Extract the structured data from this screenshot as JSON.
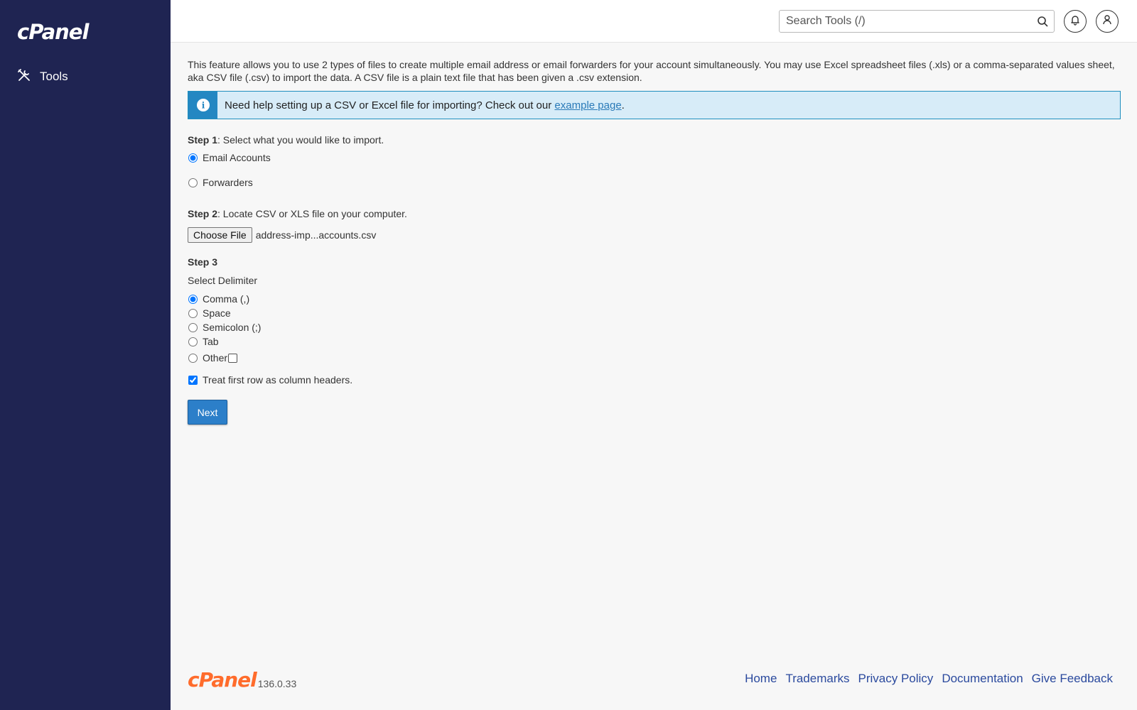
{
  "brand": {
    "logo_text": "cPanel",
    "version": "136.0.33"
  },
  "sidebar": {
    "items": [
      {
        "label": "Tools",
        "icon": "tools-icon"
      }
    ]
  },
  "header": {
    "search_placeholder": "Search Tools (/)"
  },
  "intro_text": "This feature allows you to use 2 types of files to create multiple email address or email forwarders for your account simultaneously. You may use Excel spreadsheet files (.xls) or a comma-separated values sheet, aka CSV file (.csv) to import the data. A CSV file is a plain text file that has been given a .csv extension.",
  "alert": {
    "text": "Need help setting up a CSV or Excel file for importing? Check out our",
    "link": "example page",
    "suffix": "."
  },
  "step1": {
    "label": "Step 1",
    "text": ": Select what you would like to import.",
    "options": [
      {
        "label": "Email Accounts",
        "checked": true
      },
      {
        "label": "Forwarders",
        "checked": false
      }
    ]
  },
  "step2": {
    "label": "Step 2",
    "text": ": Locate CSV or XLS file on your computer.",
    "button": "Choose File",
    "file_name": "address-imp...accounts.csv"
  },
  "step3": {
    "label": "Step 3",
    "delimiter_label": "Select Delimiter",
    "options": [
      {
        "label": "Comma (,)",
        "checked": true
      },
      {
        "label": "Space",
        "checked": false
      },
      {
        "label": "Semicolon (;)",
        "checked": false
      },
      {
        "label": "Tab",
        "checked": false
      },
      {
        "label": "Other",
        "checked": false
      }
    ],
    "header_checkbox": {
      "label": "Treat first row as column headers.",
      "checked": true
    }
  },
  "next_button": "Next",
  "footer": {
    "links": [
      "Home",
      "Trademarks",
      "Privacy Policy",
      "Documentation",
      "Give Feedback"
    ]
  },
  "colors": {
    "sidebar_bg": "#1f2452",
    "brand_orange": "#ff6c2c",
    "primary_button": "#2c7fc9",
    "alert_bg": "#d7ecf8",
    "link": "#2b4a9e"
  }
}
